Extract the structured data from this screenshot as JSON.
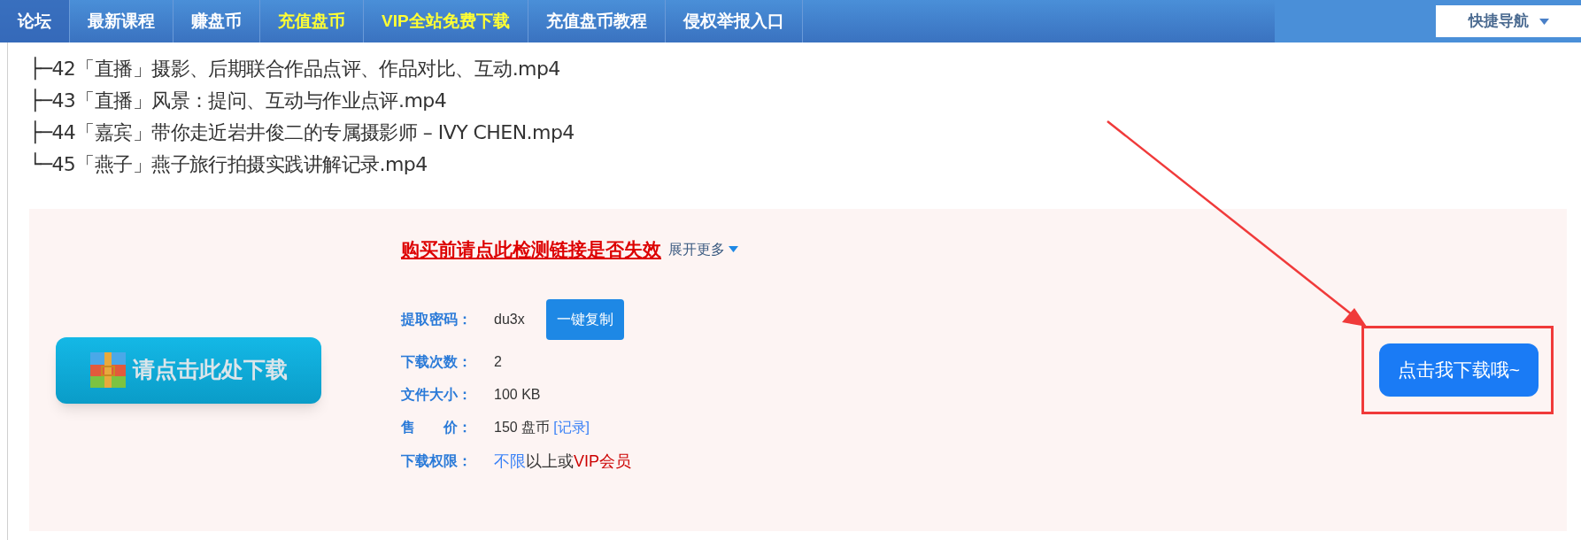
{
  "nav": {
    "items": [
      {
        "label": "论坛",
        "color": "#ffffff",
        "selected": true
      },
      {
        "label": "最新课程",
        "color": "#ffffff",
        "selected": false
      },
      {
        "label": "赚盘币",
        "color": "#ffffff",
        "selected": false
      },
      {
        "label": "充值盘币",
        "color": "#ffff33",
        "selected": false
      },
      {
        "label": "VIP全站免费下载",
        "color": "#ffff33",
        "selected": false
      },
      {
        "label": "充值盘币教程",
        "color": "#ffffff",
        "selected": false
      },
      {
        "label": "侵权举报入口",
        "color": "#ffffff",
        "selected": false
      }
    ],
    "quick_nav": "快捷导航"
  },
  "files": [
    "├─42「直播」摄影、后期联合作品点评、作品对比、互动.mp4",
    "├─43「直播」风景：提问、互动与作业点评.mp4",
    "├─44「嘉宾」带你走近岩井俊二的专属摄影师 – IVY CHEN.mp4",
    "└─45「燕子」燕子旅行拍摄实践讲解记录.mp4"
  ],
  "download": {
    "button": "请点击此处下载",
    "check_link": "购买前请点此检测链接是否失效",
    "expand": "展开更多",
    "rows": [
      {
        "kind": "code",
        "label": "提取密码：",
        "value": "du3x",
        "action": "一键复制"
      },
      {
        "kind": "plain",
        "label": "下载次数：",
        "value": "2"
      },
      {
        "kind": "plain",
        "label": "文件大小：",
        "value": "100 KB"
      },
      {
        "kind": "price",
        "label": "售　　价：",
        "value": "150 盘币",
        "link": "[记录]"
      },
      {
        "kind": "parts",
        "label": "下载权限：",
        "parts": [
          {
            "text": "不限",
            "color": "#3b82f6"
          },
          {
            "text": "以上或",
            "color": "#333333"
          },
          {
            "text": "VIP会员",
            "color": "#cc0000"
          }
        ]
      }
    ],
    "cta": "点击我下载哦~"
  }
}
